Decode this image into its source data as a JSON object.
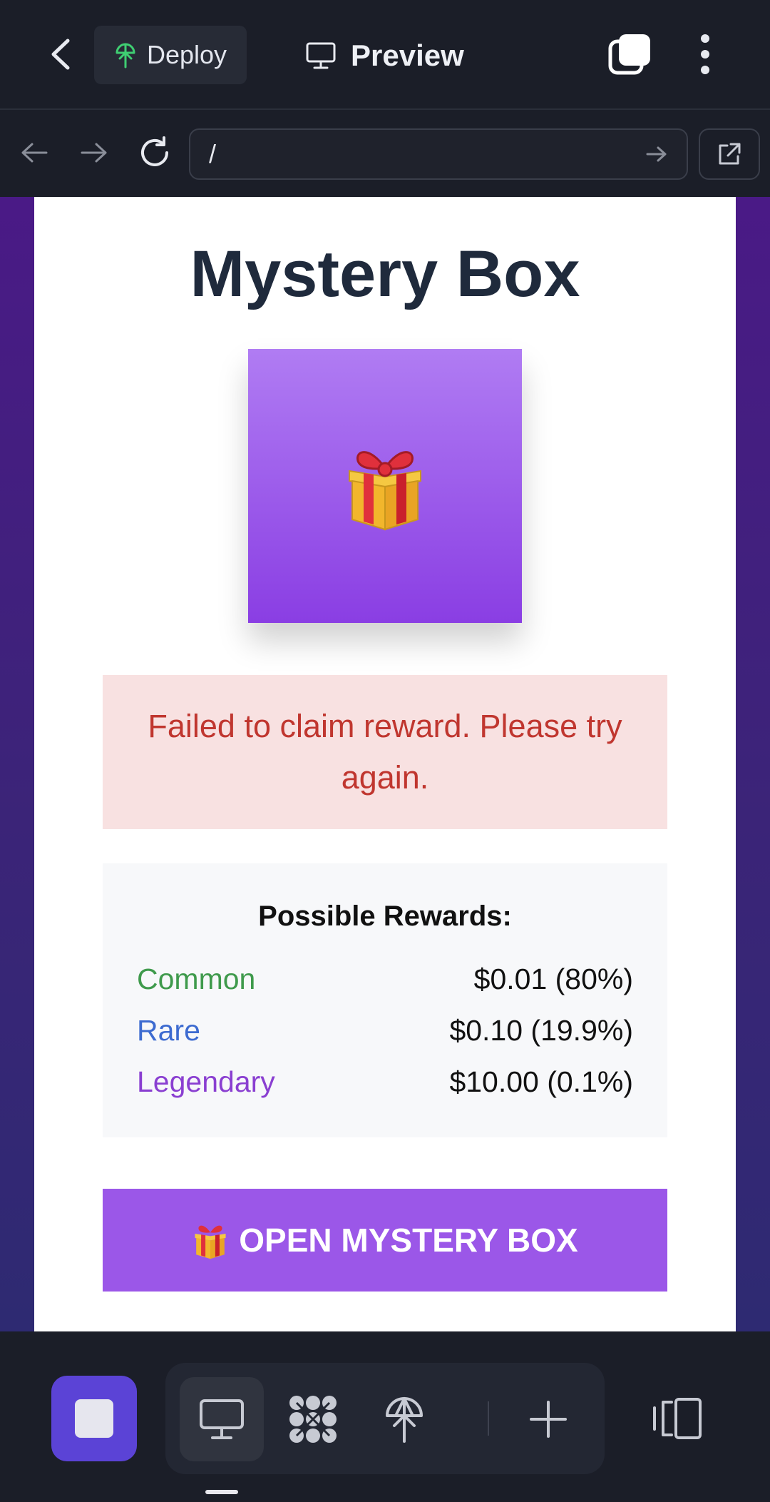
{
  "topbar": {
    "deploy_label": "Deploy",
    "preview_label": "Preview"
  },
  "urlbar": {
    "url": "/"
  },
  "page": {
    "title": "Mystery Box",
    "box_emoji": "🎁",
    "error_message": "Failed to claim reward. Please try again.",
    "rewards_title": "Possible Rewards:",
    "rewards": [
      {
        "tier": "Common",
        "value": "$0.01 (80%)",
        "color": "#3f9a4c"
      },
      {
        "tier": "Rare",
        "value": "$0.10 (19.9%)",
        "color": "#3d6bd0"
      },
      {
        "tier": "Legendary",
        "value": "$10.00 (0.1%)",
        "color": "#8a3fd1"
      }
    ],
    "open_button_emoji": "🎁",
    "open_button_label": "OPEN MYSTERY BOX"
  },
  "colors": {
    "accent": "#5b43d6",
    "button": "#9b57e8",
    "error_bg": "#f8e1e1",
    "error_text": "#c0362f"
  },
  "icons": {
    "back": "chevron-left-icon",
    "deploy": "deploy-tree-icon",
    "preview": "monitor-icon",
    "tabs": "tabs-icon",
    "more": "more-vertical-icon",
    "nav_back": "arrow-left-icon",
    "nav_forward": "arrow-right-icon",
    "reload": "reload-icon",
    "go": "arrow-right-icon",
    "external": "external-link-icon",
    "stop": "stop-icon",
    "desktop": "monitor-icon",
    "apps": "apps-icon",
    "deploy_tool": "deploy-tree-icon",
    "add": "plus-icon",
    "device": "device-frame-icon"
  }
}
